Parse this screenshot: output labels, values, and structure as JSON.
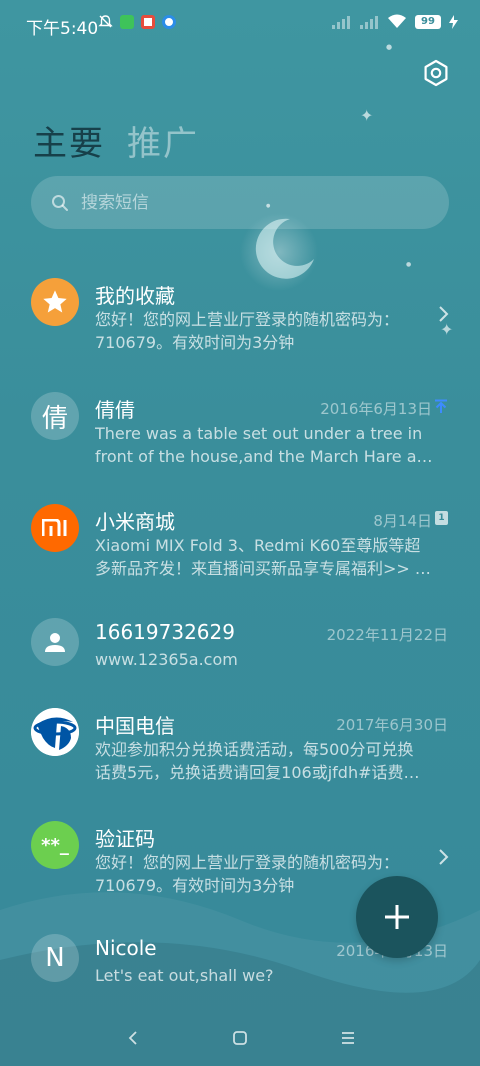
{
  "status_bar": {
    "time": "下午5:40",
    "battery": "99",
    "notification_icons": [
      "alarm-off-icon",
      "app-notification-icon",
      "news-app-icon",
      "message-app-icon"
    ],
    "right_icons": [
      "signal-1-icon",
      "signal-2-icon",
      "wifi-icon",
      "battery-icon",
      "charging-icon"
    ]
  },
  "header": {
    "tabs": [
      {
        "label": "主要",
        "active": true
      },
      {
        "label": "推广",
        "active": false
      }
    ]
  },
  "search": {
    "placeholder": "搜索短信"
  },
  "conversations": [
    {
      "name": "我的收藏",
      "date": "",
      "preview_line1": "您好！您的网上营业厅登录的随机密码为：",
      "preview_line2": "710679。有效时间为3分钟",
      "avatar": "star-icon",
      "avatar_color": "#f5a03a",
      "trailing": "chevron-right-icon"
    },
    {
      "name": "倩倩",
      "date": "2016年6月13日",
      "preview_line1": "There was a table set out under a tree in",
      "preview_line2": "front of the house,and the March Hare an…",
      "avatar_text": "倩",
      "trailing": "pin-icon"
    },
    {
      "name": "小米商城",
      "date": "8月14日",
      "preview_line1": "Xiaomi MIX Fold 3、Redmi K60至尊版等超",
      "preview_line2": "多新品齐发！来直播间买新品享专属福利>> …",
      "avatar": "mi-logo-icon",
      "avatar_color": "#ff6900",
      "sim_label": "1",
      "trailing": "sim-card-icon"
    },
    {
      "name": "16619732629",
      "date": "2022年11月22日",
      "preview_line1": "www.12365a.com",
      "preview_line2": "",
      "avatar": "person-icon"
    },
    {
      "name": "中国电信",
      "date": "2017年6月30日",
      "preview_line1": "欢迎参加积分兑换话费活动，每500分可兑换",
      "preview_line2": "话费5元，兑换话费请回复106或jfdh#话费…",
      "avatar": "china-telecom-logo-icon",
      "avatar_color": "#0055a5"
    },
    {
      "name": "验证码",
      "date": "",
      "preview_line1": "您好！您的网上营业厅登录的随机密码为：",
      "preview_line2": "710679。有效时间为3分钟",
      "avatar_text": "**_",
      "avatar_color": "#6ccf4f",
      "trailing": "chevron-right-icon"
    },
    {
      "name": "Nicole",
      "date": "2016年6月13日",
      "preview_line1": "Let's eat out,shall we?",
      "preview_line2": "",
      "avatar_text": "N"
    }
  ],
  "fab": {
    "icon": "plus-icon"
  },
  "navigation": {
    "buttons": [
      "back-icon",
      "home-icon",
      "menu-icon"
    ]
  },
  "colors": {
    "background": "#3a8e9b",
    "active_tab": "#17404a",
    "fab": "#1b545d",
    "pin_blue": "#3d8bff"
  }
}
